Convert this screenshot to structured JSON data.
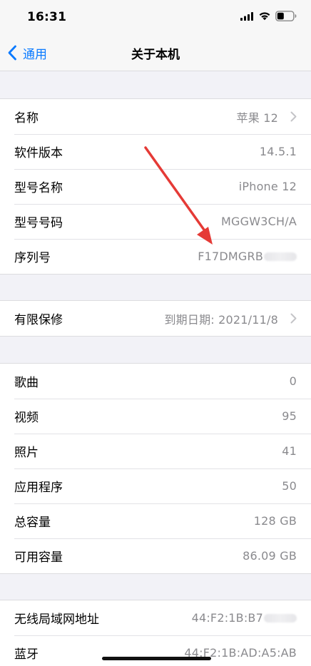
{
  "status_bar": {
    "time": "16:31",
    "icons": [
      "signal-icon",
      "wifi-icon",
      "battery-icon"
    ]
  },
  "nav": {
    "back_label": "通用",
    "title": "关于本机"
  },
  "colors": {
    "accent": "#0a7aff",
    "secondary_text": "#8a8a8e",
    "background": "#f2f2f7",
    "annotation_arrow": "#e53a36"
  },
  "group1": {
    "rows": [
      {
        "label": "名称",
        "value": "苹果 12"
      },
      {
        "label": "软件版本",
        "value": "14.5.1"
      },
      {
        "label": "型号名称",
        "value": "iPhone 12"
      },
      {
        "label": "型号号码",
        "value": "MGGW3CH/A"
      },
      {
        "label": "序列号",
        "value": "F17DMGRB"
      }
    ]
  },
  "group2": {
    "rows": [
      {
        "label": "有限保修",
        "value": "到期日期: 2021/11/8"
      }
    ]
  },
  "group3": {
    "rows": [
      {
        "label": "歌曲",
        "value": "0"
      },
      {
        "label": "视频",
        "value": "95"
      },
      {
        "label": "照片",
        "value": "41"
      },
      {
        "label": "应用程序",
        "value": "50"
      },
      {
        "label": "总容量",
        "value": "128 GB"
      },
      {
        "label": "可用容量",
        "value": "86.09 GB"
      }
    ]
  },
  "group4": {
    "rows": [
      {
        "label": "无线局域网地址",
        "value": "44:F2:1B:B7"
      },
      {
        "label": "蓝牙",
        "value": "44:F2:1B:AD:A5:AB"
      }
    ]
  }
}
